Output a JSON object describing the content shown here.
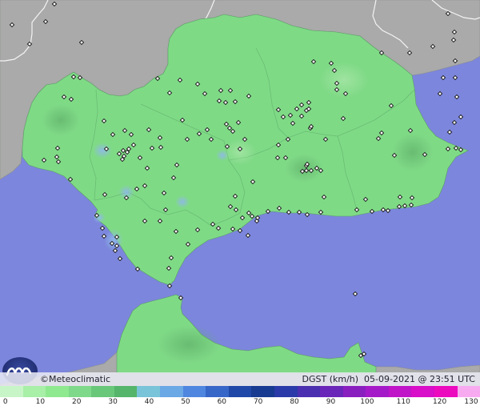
{
  "credit": {
    "symbol": "©",
    "brand": "Meteoclimatic"
  },
  "product": {
    "variable": "DGST",
    "unit": "(km/h)",
    "date": "05-09-2021",
    "at": "@",
    "time": "23:51 UTC"
  },
  "legend": {
    "ticks": [
      "0",
      "10",
      "20",
      "30",
      "40",
      "50",
      "60",
      "70",
      "80",
      "90",
      "100",
      "110",
      "120",
      "130"
    ],
    "colors": [
      "#c8f5c8",
      "#a8efa8",
      "#8fe98f",
      "#7fd98a",
      "#69c77a",
      "#55b56b",
      "#79c4d8",
      "#6aa8e6",
      "#4f86e0",
      "#3666c8",
      "#1f48a8",
      "#183a90",
      "#2a3aa8",
      "#4a2fb0",
      "#6a26b8",
      "#8a1fc0",
      "#a51ac8",
      "#c014c8",
      "#d80ec8",
      "#ec0abf",
      "#f8aaf0"
    ]
  },
  "map": {
    "stations": [
      [
        15,
        31
      ],
      [
        57,
        27
      ],
      [
        68,
        5
      ],
      [
        102,
        53
      ],
      [
        37,
        55
      ],
      [
        560,
        17
      ],
      [
        568,
        40
      ],
      [
        567,
        50
      ],
      [
        541,
        58
      ],
      [
        569,
        76
      ],
      [
        512,
        66
      ],
      [
        477,
        66
      ],
      [
        554,
        97
      ],
      [
        569,
        97
      ],
      [
        550,
        117
      ],
      [
        571,
        121
      ],
      [
        576,
        146
      ],
      [
        568,
        153
      ],
      [
        562,
        165
      ],
      [
        92,
        96
      ],
      [
        100,
        97
      ],
      [
        80,
        121
      ],
      [
        89,
        124
      ],
      [
        197,
        98
      ],
      [
        212,
        116
      ],
      [
        225,
        100
      ],
      [
        247,
        105
      ],
      [
        256,
        117
      ],
      [
        276,
        113
      ],
      [
        274,
        126
      ],
      [
        282,
        128
      ],
      [
        288,
        113
      ],
      [
        294,
        127
      ],
      [
        311,
        120
      ],
      [
        130,
        151
      ],
      [
        141,
        168
      ],
      [
        156,
        163
      ],
      [
        164,
        168
      ],
      [
        167,
        181
      ],
      [
        161,
        186
      ],
      [
        154,
        188
      ],
      [
        149,
        192
      ],
      [
        159,
        190
      ],
      [
        155,
        195
      ],
      [
        153,
        199
      ],
      [
        133,
        186
      ],
      [
        190,
        185
      ],
      [
        175,
        197
      ],
      [
        186,
        162
      ],
      [
        200,
        172
      ],
      [
        201,
        184
      ],
      [
        228,
        150
      ],
      [
        234,
        174
      ],
      [
        249,
        167
      ],
      [
        259,
        162
      ],
      [
        264,
        174
      ],
      [
        284,
        183
      ],
      [
        300,
        186
      ],
      [
        306,
        174
      ],
      [
        283,
        155
      ],
      [
        287,
        160
      ],
      [
        291,
        164
      ],
      [
        298,
        153
      ],
      [
        348,
        137
      ],
      [
        354,
        146
      ],
      [
        363,
        144
      ],
      [
        366,
        154
      ],
      [
        377,
        145
      ],
      [
        383,
        138
      ],
      [
        386,
        128
      ],
      [
        371,
        136
      ],
      [
        377,
        131
      ],
      [
        386,
        136
      ],
      [
        388,
        160
      ],
      [
        389,
        158
      ],
      [
        429,
        148
      ],
      [
        421,
        112
      ],
      [
        414,
        79
      ],
      [
        392,
        77
      ],
      [
        418,
        88
      ],
      [
        421,
        104
      ],
      [
        432,
        117
      ],
      [
        489,
        132
      ],
      [
        477,
        166
      ],
      [
        473,
        173
      ],
      [
        493,
        194
      ],
      [
        513,
        163
      ],
      [
        531,
        193
      ],
      [
        560,
        186
      ],
      [
        570,
        185
      ],
      [
        576,
        187
      ],
      [
        383,
        207
      ],
      [
        389,
        213
      ],
      [
        378,
        214
      ],
      [
        384,
        205
      ],
      [
        383,
        213
      ],
      [
        396,
        210
      ],
      [
        401,
        213
      ],
      [
        407,
        174
      ],
      [
        405,
        246
      ],
      [
        360,
        174
      ],
      [
        357,
        197
      ],
      [
        347,
        197
      ],
      [
        348,
        181
      ],
      [
        316,
        227
      ],
      [
        294,
        245
      ],
      [
        288,
        258
      ],
      [
        295,
        262
      ],
      [
        303,
        272
      ],
      [
        311,
        266
      ],
      [
        315,
        270
      ],
      [
        321,
        276
      ],
      [
        322,
        272
      ],
      [
        310,
        294
      ],
      [
        300,
        288
      ],
      [
        291,
        286
      ],
      [
        273,
        285
      ],
      [
        266,
        280
      ],
      [
        247,
        287
      ],
      [
        235,
        305
      ],
      [
        220,
        289
      ],
      [
        214,
        322
      ],
      [
        207,
        262
      ],
      [
        205,
        241
      ],
      [
        217,
        222
      ],
      [
        221,
        206
      ],
      [
        184,
        210
      ],
      [
        181,
        232
      ],
      [
        171,
        236
      ],
      [
        200,
        276
      ],
      [
        181,
        276
      ],
      [
        158,
        247
      ],
      [
        131,
        243
      ],
      [
        121,
        269
      ],
      [
        128,
        285
      ],
      [
        130,
        295
      ],
      [
        140,
        304
      ],
      [
        146,
        296
      ],
      [
        146,
        307
      ],
      [
        144,
        313
      ],
      [
        150,
        323
      ],
      [
        172,
        336
      ],
      [
        211,
        335
      ],
      [
        212,
        357
      ],
      [
        226,
        372
      ],
      [
        55,
        200
      ],
      [
        71,
        196
      ],
      [
        72,
        185
      ],
      [
        73,
        202
      ],
      [
        88,
        224
      ],
      [
        457,
        249
      ],
      [
        446,
        262
      ],
      [
        465,
        264
      ],
      [
        479,
        262
      ],
      [
        485,
        263
      ],
      [
        499,
        258
      ],
      [
        500,
        246
      ],
      [
        515,
        247
      ],
      [
        514,
        256
      ],
      [
        506,
        257
      ],
      [
        401,
        265
      ],
      [
        384,
        268
      ],
      [
        374,
        265
      ],
      [
        361,
        265
      ],
      [
        349,
        260
      ],
      [
        335,
        264
      ],
      [
        444,
        367
      ],
      [
        451,
        444
      ],
      [
        455,
        442
      ]
    ]
  }
}
